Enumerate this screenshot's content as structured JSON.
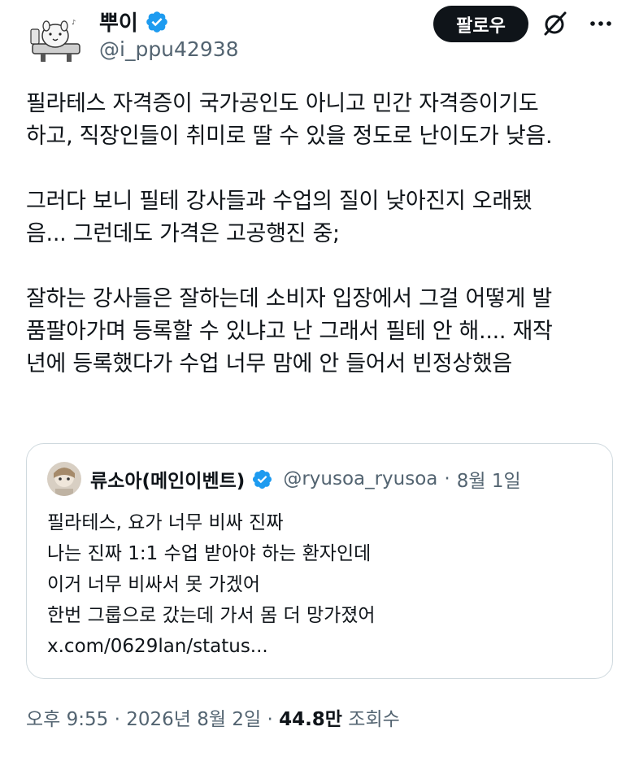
{
  "author": {
    "display_name": "뿌이",
    "handle": "@i_ppu42938"
  },
  "follow_label": "팔로우",
  "tweet_text": "필라테스 자격증이 국가공인도 아니고 민간 자격증이기도\n하고, 직장인들이 취미로 딸 수 있을 정도로 난이도가 낮음.\n\n그러다 보니 필테 강사들과 수업의 질이 낮아진지 오래됐\n음... 그런데도 가격은 고공행진 중;\n\n잘하는 강사들은 잘하는데 소비자 입장에서 그걸 어떻게 발\n품팔아가며 등록할 수 있냐고 난 그래서 필테 안 해.... 재작\n년에 등록했다가 수업 너무 맘에 안 들어서 빈정상했음",
  "quoted": {
    "display_name": "류소아(메인이벤트)",
    "handle": "@ryusoa_ryusoa",
    "separator": "·",
    "date": "8월 1일",
    "text": "필라테스, 요가 너무 비싸 진짜\n나는 진짜 1:1 수업 받아야 하는 환자인데\n이거 너무 비싸서 못 가겠어\n한번 그룹으로 갔는데 가서 몸 더 망가졌어\nx.com/0629lan/status..."
  },
  "meta": {
    "time": "오후 9:55",
    "sep1": "·",
    "date": "2026년 8월 2일",
    "sep2": "·",
    "views": "44.8만",
    "views_label": "조회수"
  },
  "colors": {
    "verified": "#1d9bf0",
    "text": "#0f1419",
    "secondary": "#536471",
    "border": "#cfd9de"
  },
  "icons": [
    "verified-badge-icon",
    "grok-icon",
    "more-icon"
  ]
}
